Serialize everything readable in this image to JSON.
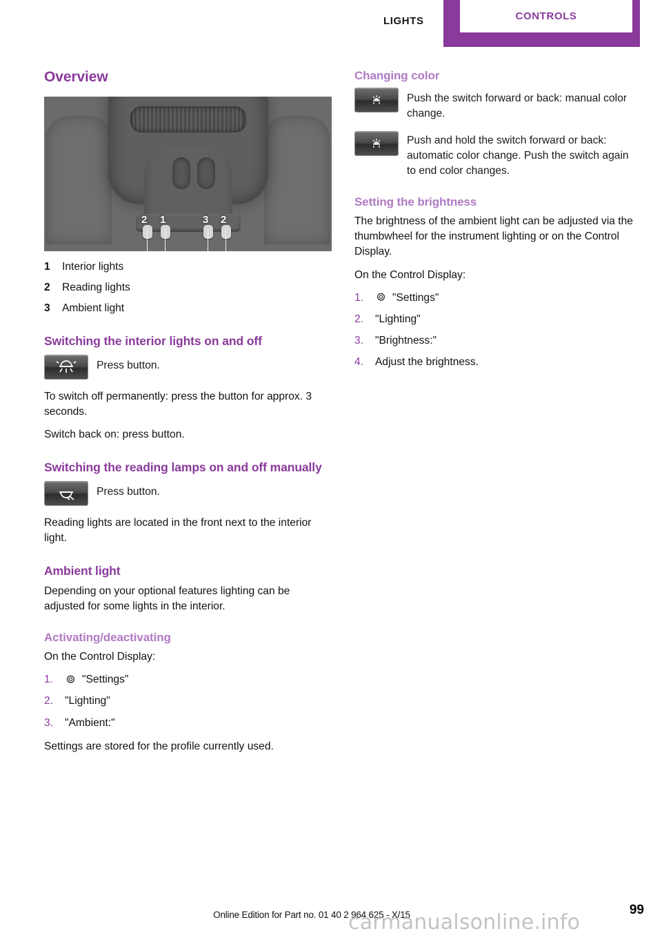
{
  "header": {
    "tab_inactive": "LIGHTS",
    "tab_active": "CONTROLS",
    "accent_color": "#8a3a9b"
  },
  "left_column": {
    "overview_title": "Overview",
    "photo": {
      "alt": "Overhead console with interior, reading and ambient lights",
      "callouts": [
        "2",
        "1",
        "3",
        "2"
      ]
    },
    "legend": [
      {
        "num": "1",
        "label": "Interior lights"
      },
      {
        "num": "2",
        "label": "Reading lights"
      },
      {
        "num": "3",
        "label": "Ambient light"
      }
    ],
    "interior_heading": "Switching the interior lights on and off",
    "interior_icon_text": "Press button.",
    "interior_icon_name": "interior-light-button-icon",
    "interior_p1": "To switch off permanently: press the button for approx. 3 seconds.",
    "interior_p2": "Switch back on: press button.",
    "reading_heading": "Switching the reading lamps on and off manually",
    "reading_icon_text": "Press button.",
    "reading_icon_name": "reading-lamp-button-icon",
    "reading_p1": "Reading lights are located in the front next to the interior light.",
    "ambient_heading": "Ambient light",
    "ambient_p1": "Depending on your optional features lighting can be adjusted for some lights in the interior.",
    "activating_heading": "Activating/deactivating",
    "activating_intro": "On the Control Display:",
    "activating_steps": [
      {
        "num": "1.",
        "icon": "settings-gear-icon",
        "label": "\"Settings\""
      },
      {
        "num": "2.",
        "icon": "",
        "label": "\"Lighting\""
      },
      {
        "num": "3.",
        "icon": "",
        "label": "\"Ambient:\""
      }
    ],
    "activating_note": "Settings are stored for the profile currently used."
  },
  "right_column": {
    "changing_color_heading": "Changing color",
    "color_row1_icon": "ambient-switch-icon",
    "color_row1_text": "Push the switch forward or back: manual color change.",
    "color_row2_icon": "ambient-switch-icon",
    "color_row2_text": "Push and hold the switch forward or back: automatic color change. Push the switch again to end color changes.",
    "brightness_heading": "Setting the brightness",
    "brightness_p1": "The brightness of the ambient light can be adjusted via the thumbwheel for the instrument lighting or on the Control Display.",
    "brightness_intro": "On the Control Display:",
    "brightness_steps": [
      {
        "num": "1.",
        "icon": "settings-gear-icon",
        "label": "\"Settings\""
      },
      {
        "num": "2.",
        "icon": "",
        "label": "\"Lighting\""
      },
      {
        "num": "3.",
        "icon": "",
        "label": "\"Brightness:\""
      },
      {
        "num": "4.",
        "icon": "",
        "label": "Adjust the brightness."
      }
    ]
  },
  "footer": {
    "note": "Online Edition for Part no. 01 40 2 964 625 - X/15",
    "page_number": "99",
    "watermark": "carmanualsonline.info"
  }
}
